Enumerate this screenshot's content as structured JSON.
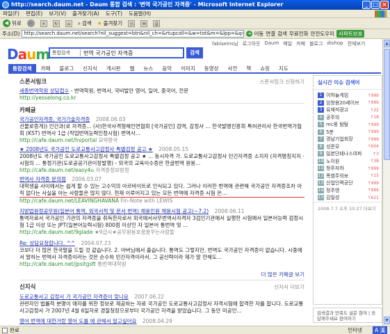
{
  "window": {
    "title": "http://search.daum.net - Daum 통합 검색 : '변역 국가공인 자격증' - Microsoft Internet Explorer",
    "min": "_",
    "max": "□",
    "close": "×"
  },
  "menu": [
    "파일(F)",
    "편집(E)",
    "보기(V)",
    "즐겨찾기(A)",
    "도구(T)",
    "도움말(H)"
  ],
  "toolbar": {
    "back": "뒤로",
    "search": "검색",
    "favorites": "즐겨찾기"
  },
  "address": {
    "label": "주소(D)",
    "url": "http://search.daum.net/search?nil_suggest=btn&nil_ch=&rtupcoll=&w=tot&m=&lpp=&q=%B9%F8%BF%AA+%B1%B",
    "go": "이동",
    "links": "연결",
    "search_btn": "검색",
    "free_call": "무료전화",
    "safe": "안전도우미",
    "safe_btn": "사파트보호"
  },
  "daum": {
    "logo": "Daum",
    "search_cat": "통합검색",
    "query": "번역 국가공인 자격증",
    "search_btn": "검색",
    "topnav": [
      "fabiseins님",
      "로그아웃",
      "Daum",
      "메일",
      "카페",
      "블로그",
      "dishop",
      "전체보기"
    ],
    "tabs": [
      "통합검색",
      "카페",
      "블로그",
      "신지식",
      "게시판",
      "웹",
      "뉴스",
      "음악",
      "이미지",
      "동영상",
      "사전",
      "책",
      "쇼핑",
      "지도"
    ]
  },
  "sponsor": {
    "heading": "스폰서링크",
    "right": "스폰서링크 신청하기",
    "title": "세종번역학원 상담접수",
    "desc": " - 번역학원, 번역사, 국비발안 영어, 일어, 중국어, 전문",
    "url": "http://yesselong.co.kr"
  },
  "cafe": {
    "heading": "카페글",
    "items": [
      {
        "title": "국가공인자격증, 국가기술자격증",
        "date": "2008.06.03",
        "snippet": "선물로증게)) 인간과(로 자격증... (사)한국사격형해인연협회 [국가공인] 검역, 감정사 ... 한국발명진흥회 특허관리사 한국번역가협회 (KST) 번역사 1급 (작업번역능력인정시험) 번역사...",
        "url": "http://cafe.daum.net/hvportal",
        "source": "요약환국"
      },
      {
        "title": "★ 2008년도 국가공인 도로교통사고감정사 특별검정 공고 ★",
        "date": "2008.05.15",
        "snippet": "2008년도 국가공인 도로교통사고감정사 특별검정 공고 ★ ... 동시자격 가. 도로교통사고감정사 민간자격증 소지자 (자격명칭지지 · 시험의 ... 통정기관(도로공공기관이장발행) - 외국의 교육이수증은 한글번역 원용...",
        "url": "http://cafe.daum.net/easy4u",
        "source": "자격증정보방정"
      },
      {
        "title": "번역사 자격증 문의점",
        "date": "2006.03.07",
        "snippet": "대학생을 사이에서는 쉽게 할 수 있는 고수익의 아르바이트로 인식되고 있다. 그러나 이러한 번역에 관련해 국가공인 자격증조차 아직 없다는 사실을 아는 사람들은 많지 않다. 현재 이루어지고 있는 모든 번역에 자격증 시험 은...",
        "url": "http://cafe.daum.net/LEAVINGHAVANA",
        "source": "Fin-Note with LEWIS"
      },
      {
        "title": "지방법원정공무원(일본어 통역, 외국서적 및 문서 번역) 채용인원 채용시험 공고(~7.2)",
        "date": "2008.06.11",
        "snippet": "통역자료서 국가공인 기관의 자격증을 취득한자로서 외국에서사무번역사자격자 3검인기관에서 실행한 시험에서 일본어능력 검정시험 1급 이상 또는 JPT(일본어능력시험) 800점 이상인 자 일본어 통번역 및 ...",
        "url": "http://cafe.daum.net/9glade",
        "source": "★9급시★공무원동호꿈꿈꾸는사람들"
      },
      {
        "title": "Re: 상담요청합니다. ^^",
        "date": "2004.07.23",
        "snippet": "코보다 더 많은 한국말을 드릴 것 같습니다. 2. 아버님에서 출습니다. 통역도 그렇지만, 번역도 국가공인 자격증이 없습니다. 시중에서 말하는 번역사 자격증이라는 것은 순수하 민간자격이라서, 그 공신력이라 제가 말 안해도...",
        "url": "http://cafe.daum.net/jpsitgsft",
        "source": "통번역대학원"
      }
    ],
    "more": "더 많은 카페글 보기"
  },
  "knowledge": {
    "heading": "신지식",
    "right": "신지식 더보기",
    "items": [
      {
        "title": "도로교통사고 감정사 가 국가공인 자격증이 맞나요",
        "date": "2007.06.22",
        "snippet": "관련자인 법률적 분명이 애자를 위한 정보로 제공하는 자료 국가공인 도로교통사고감정사 자격시험에 합격한 자를 합니다. 도로교통사고감정사 가 2007년 4월 6일자로 경찰청장으로부터 국가공인 자격을 받았습니다. 그 동안 미공인..."
      },
      {
        "title": "영어 번역에 대한거랑 영어 도를 에 관해서 알고싶어요",
        "date": "2008.04.29",
        "snippet": ""
      }
    ]
  },
  "ranking": {
    "heading": "실시간 이슈 검색어",
    "items": [
      {
        "n": "1",
        "t": "이하늘게임",
        "c": "↑999"
      },
      {
        "n": "2",
        "t": "임창용20세이브",
        "c": "↑999"
      },
      {
        "n": "3",
        "t": "유재석광고",
        "c": "↑22"
      },
      {
        "n": "4",
        "t": "공주의",
        "c": "↑18"
      },
      {
        "n": "5",
        "t": "mc몽 탐탐",
        "c": "↑999"
      },
      {
        "n": "6",
        "t": "5분",
        "c": "↑999"
      },
      {
        "n": "7",
        "t": "경남기업회장",
        "c": "↑999"
      },
      {
        "n": "8",
        "t": "성준모",
        "c": "↑604"
      },
      {
        "n": "9",
        "t": "일본단테나스여파",
        "c": "↑3"
      },
      {
        "n": "10",
        "t": "노이원",
        "c": "↑38"
      },
      {
        "n": "11",
        "t": "청주자하",
        "c": "↑999"
      },
      {
        "n": "12",
        "t": "폭염주의보",
        "c": "↑15"
      },
      {
        "n": "13",
        "t": "산업인력공단",
        "c": "↑999"
      },
      {
        "n": "14",
        "t": "정주영",
        "c": "↑999"
      },
      {
        "n": "15",
        "t": "김일성",
        "c": "↑621"
      }
    ],
    "footer": "2008.7.7 오후 10:27  더보기",
    "survey": "검색결과 만족도 설문 참여 | 응답해주세요 참여하기"
  },
  "status": {
    "text": "완료",
    "zone": "인터넷",
    "ime": "A 漢"
  }
}
